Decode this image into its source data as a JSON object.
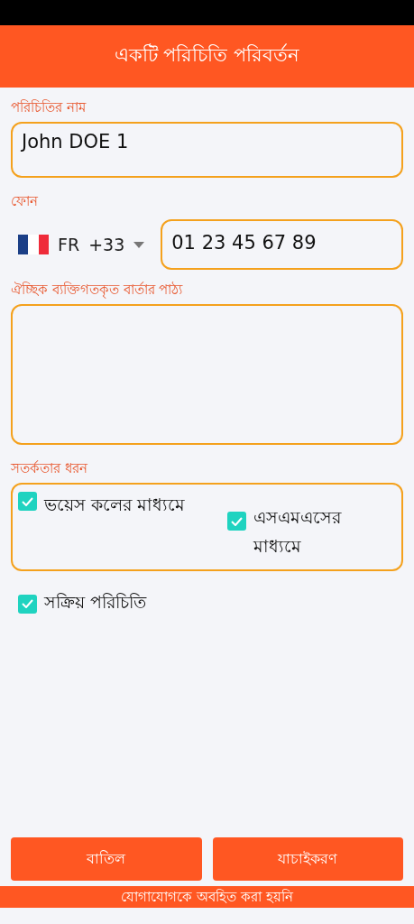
{
  "header": {
    "title": "একটি পরিচিতি পরিবর্তন"
  },
  "name_field": {
    "label": "পরিচিতির নাম",
    "value": "John DOE 1"
  },
  "phone": {
    "label": "ফোন",
    "country_code": "FR",
    "dial_code": "+33",
    "value": "01 23 45 67 89"
  },
  "message_field": {
    "label": "ঐচ্ছিক ব্যক্তিগতকৃত বার্তার পাঠ্য"
  },
  "alert_type": {
    "label": "সতর্কতার ধরন",
    "options": [
      {
        "label": "ভয়েস কলের মাধ্যমে",
        "checked": true
      },
      {
        "label": "এসএমএসের মাধ্যমে",
        "checked": true
      }
    ]
  },
  "active_contact": {
    "label": "সক্রিয় পরিচিতি",
    "checked": true
  },
  "buttons": [
    {
      "label": "বাতিল"
    },
    {
      "label": "যাচাইকরণ"
    }
  ],
  "footer_notice": "যোগাযোগকে অবহিত করা হয়নি"
}
